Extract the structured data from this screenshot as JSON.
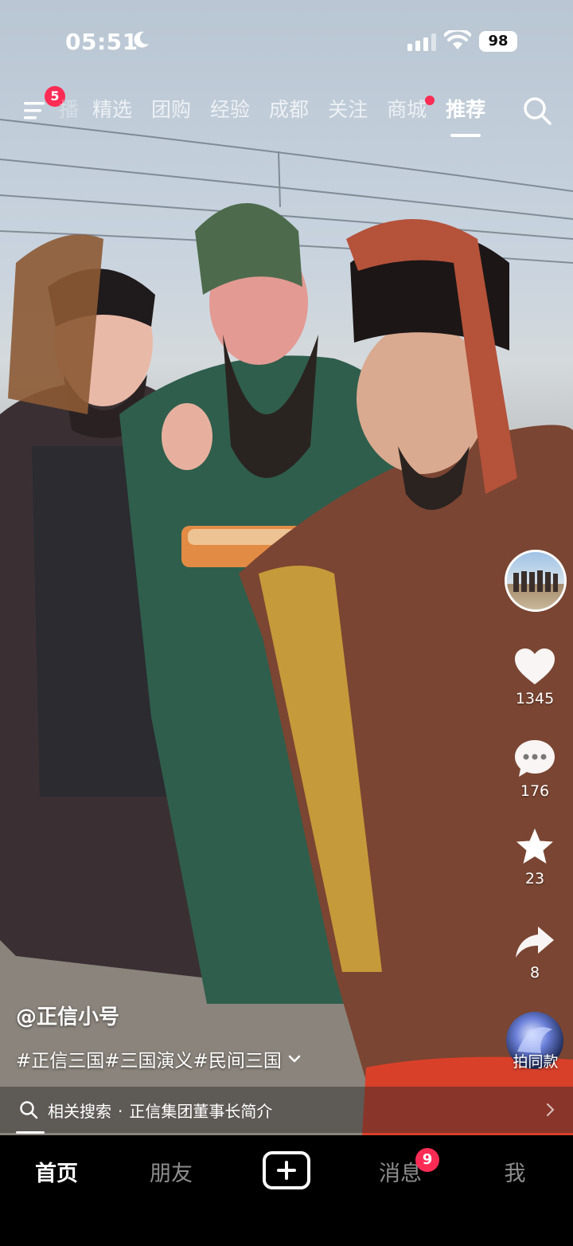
{
  "status_bar": {
    "time": "05:51",
    "battery": "98"
  },
  "top_nav": {
    "menu_badge": "5",
    "tabs": [
      "播",
      "精选",
      "团购",
      "经验",
      "成都",
      "关注",
      "商城",
      "推荐"
    ],
    "active_tab": "推荐",
    "tab_with_dot": "商城"
  },
  "actions": {
    "likes": "1345",
    "comments": "176",
    "favorites": "23",
    "shares": "8",
    "same_style_label": "拍同款"
  },
  "caption": {
    "author": "@正信小号",
    "hashtags": "#正信三国#三国演义#民间三国"
  },
  "related_search": {
    "prefix": "相关搜索",
    "separator": "·",
    "query": "正信集团董事长简介"
  },
  "bottom_nav": {
    "home": "首页",
    "friends": "朋友",
    "messages": "消息",
    "messages_badge": "9",
    "me": "我"
  },
  "colors": {
    "accent": "#fe2c55",
    "nav_bg": "#000000"
  },
  "icons": [
    "moon-icon",
    "signal-icon",
    "wifi-icon",
    "menu-icon",
    "search-icon",
    "heart-icon",
    "comment-icon",
    "star-icon",
    "share-icon",
    "chevron-down-icon",
    "chevron-right-icon",
    "plus-icon"
  ]
}
